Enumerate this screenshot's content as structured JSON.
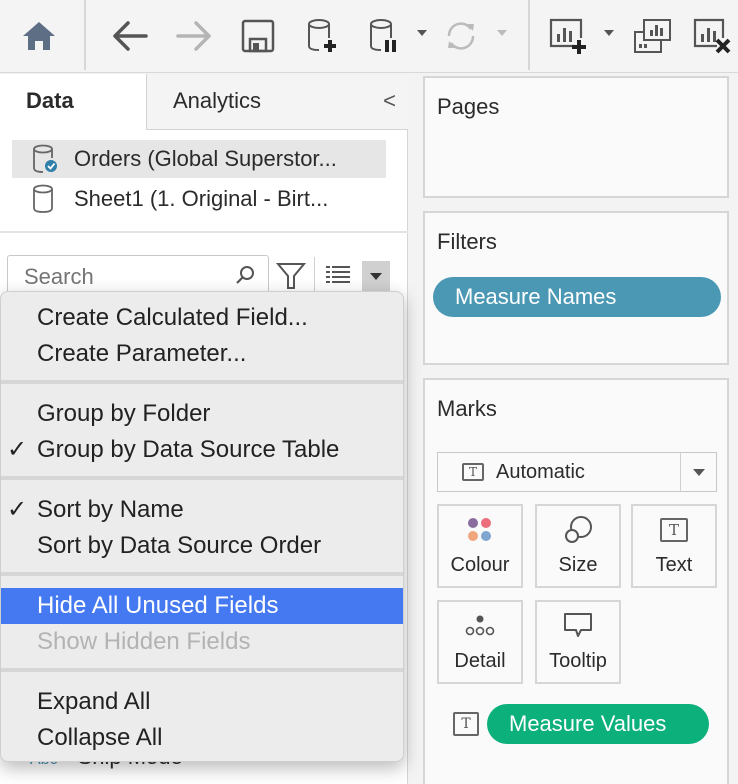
{
  "toolbar": {
    "buttons": [
      {
        "icon": "home-icon"
      },
      {
        "icon": "back-arrow-icon"
      },
      {
        "icon": "forward-arrow-icon",
        "disabled": true
      },
      {
        "icon": "save-icon"
      },
      {
        "icon": "new-data-source-icon"
      },
      {
        "icon": "pause-auto-updates-icon"
      },
      {
        "icon": "refresh-icon",
        "disabled": true
      },
      {
        "icon": "new-worksheet-icon"
      },
      {
        "icon": "duplicate-sheet-icon"
      },
      {
        "icon": "clear-sheet-icon"
      }
    ]
  },
  "left_pane": {
    "tabs": [
      {
        "label": "Data",
        "active": true
      },
      {
        "label": "Analytics",
        "active": false
      }
    ],
    "collapse_glyph": "<",
    "data_sources": [
      {
        "label": "Orders (Global Superstor...",
        "selected": true,
        "primary": true
      },
      {
        "label": "Sheet1 (1. Original - Birt...",
        "selected": false,
        "primary": false
      }
    ],
    "search": {
      "placeholder": "Search",
      "value": ""
    },
    "field_peek": {
      "type_label": "Abc",
      "label": "Ship Mode"
    }
  },
  "menu": {
    "groups": [
      [
        {
          "label": "Create Calculated Field...",
          "checked": false
        },
        {
          "label": "Create Parameter...",
          "checked": false
        }
      ],
      [
        {
          "label": "Group by Folder",
          "checked": false
        },
        {
          "label": "Group by Data Source Table",
          "checked": true
        }
      ],
      [
        {
          "label": "Sort by Name",
          "checked": true
        },
        {
          "label": "Sort by Data Source Order",
          "checked": false
        }
      ],
      [
        {
          "label": "Hide All Unused Fields",
          "highlighted": true
        },
        {
          "label": "Show Hidden Fields",
          "disabled": true
        }
      ],
      [
        {
          "label": "Expand All"
        },
        {
          "label": "Collapse All"
        }
      ]
    ],
    "check_glyph": "✓"
  },
  "shelves": {
    "pages": {
      "title": "Pages"
    },
    "filters": {
      "title": "Filters",
      "pills": [
        {
          "label": "Measure Names",
          "color": "#4b98b5"
        }
      ]
    },
    "marks": {
      "title": "Marks",
      "mark_type": "Automatic",
      "cards": [
        {
          "label": "Colour",
          "icon": "colour-icon"
        },
        {
          "label": "Size",
          "icon": "size-icon"
        },
        {
          "label": "Text",
          "icon": "text-icon"
        },
        {
          "label": "Detail",
          "icon": "detail-icon"
        },
        {
          "label": "Tooltip",
          "icon": "tooltip-icon"
        }
      ],
      "fields": [
        {
          "label": "Measure Values",
          "encoding": "text-icon",
          "color": "#0bb07b"
        }
      ]
    }
  }
}
